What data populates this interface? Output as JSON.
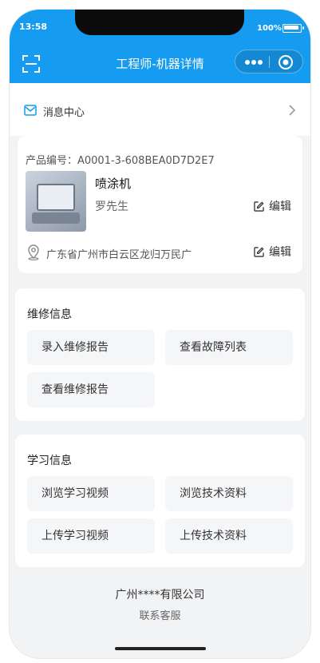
{
  "status_bar": {
    "time": "13:58",
    "battery": "100%"
  },
  "nav": {
    "title": "工程师-机器详情"
  },
  "message_center": {
    "label": "消息中心"
  },
  "product": {
    "number_label": "产品编号：A0001-3-608BEA0D7D2E7",
    "name": "喷涂机",
    "owner": "罗先生",
    "edit_label_1": "编辑",
    "address": "广东省广州市白云区龙归万民广",
    "edit_label_2": "编辑"
  },
  "repair": {
    "title": "维修信息",
    "buttons": [
      "录入维修报告",
      "查看故障列表",
      "查看维修报告"
    ]
  },
  "learning": {
    "title": "学习信息",
    "buttons": [
      "浏览学习视频",
      "浏览技术资料",
      "上传学习视频",
      "上传技术资料"
    ]
  },
  "footer": {
    "company": "广州****有限公司",
    "service": "联系客服"
  },
  "colors": {
    "primary": "#159cf0",
    "background": "#f2f3f5"
  },
  "icons": [
    "scan-icon",
    "more-icon",
    "close-target-icon",
    "mail-icon",
    "chevron-right-icon",
    "edit-icon",
    "location-icon"
  ]
}
